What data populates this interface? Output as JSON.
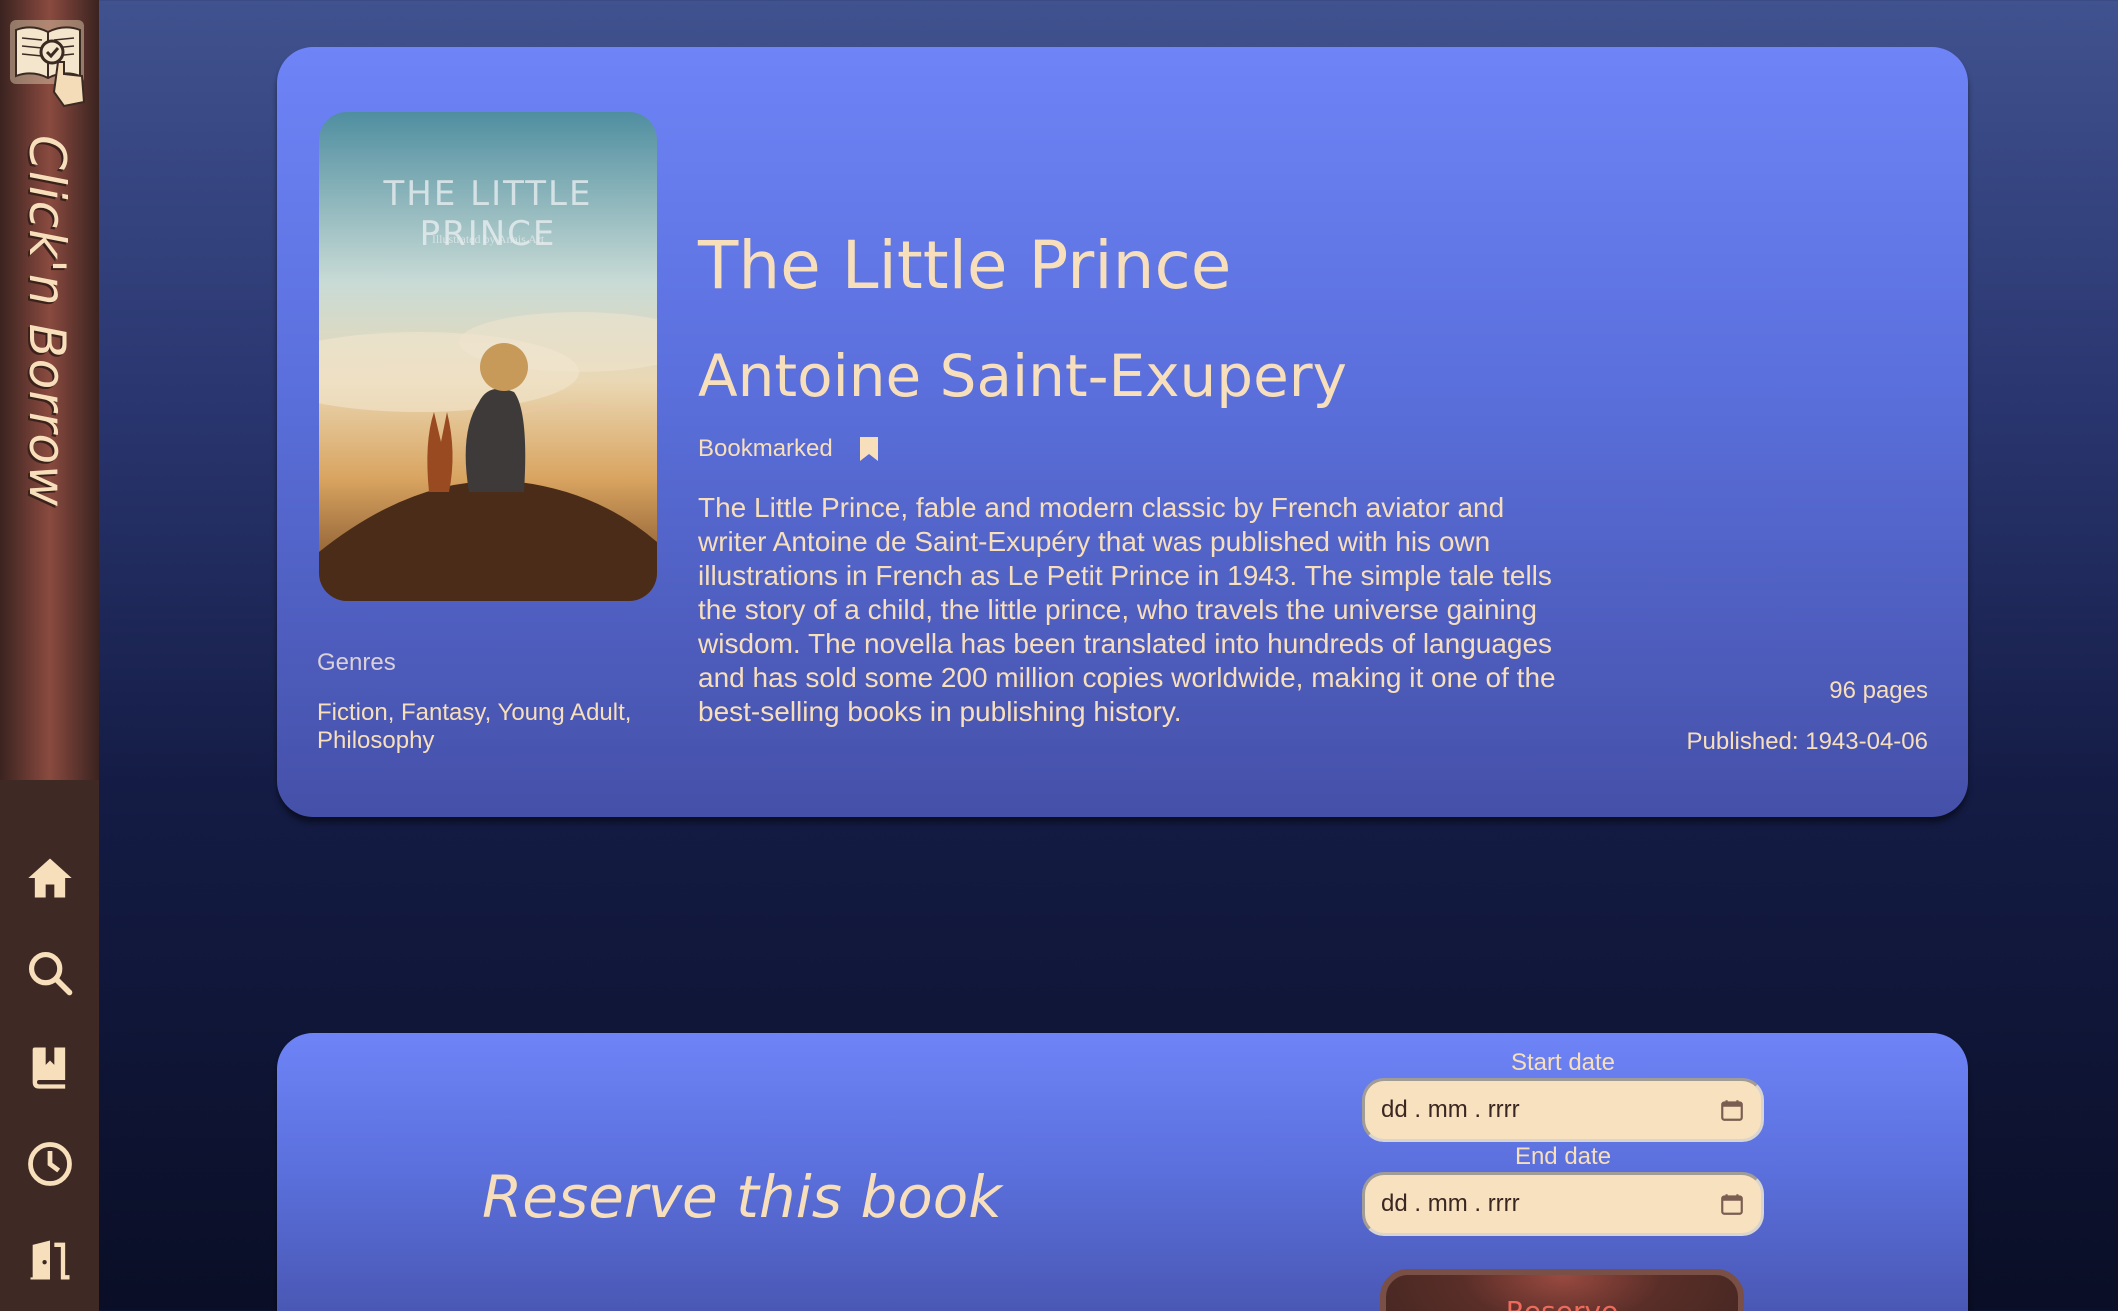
{
  "app": {
    "name": "Click'n Borrow"
  },
  "nav": [
    {
      "icon": "home-icon",
      "label": "Home"
    },
    {
      "icon": "search-icon",
      "label": "Search"
    },
    {
      "icon": "bookmark-book-icon",
      "label": "Bookmarks"
    },
    {
      "icon": "history-clock-icon",
      "label": "History"
    },
    {
      "icon": "logout-door-icon",
      "label": "Logout"
    }
  ],
  "book": {
    "cover_text": "THE LITTLE PRINCE",
    "cover_subtext": "Illustrated by Anais Art",
    "title": "The Little Prince",
    "author": "Antoine Saint-Exupery",
    "bookmark_status": "Bookmarked",
    "description": "The Little Prince, fable and modern classic by French aviator and writer Antoine de Saint-Exupéry that was published with his own illustrations in French as Le Petit Prince in 1943. The simple tale tells the story of a child, the little prince, who travels the universe gaining wisdom. The novella has been translated into hundreds of languages and has sold some 200 million copies worldwide, making it one of the best-selling books in publishing history.",
    "genres_label": "Genres",
    "genres": "Fiction, Fantasy, Young Adult, Philosophy",
    "pages": "96 pages",
    "published": "Published: 1943-04-06"
  },
  "reserve": {
    "title": "Reserve this book",
    "start_label": "Start date",
    "start_placeholder": "dd . mm . rrrr",
    "end_label": "End date",
    "end_placeholder": "dd . mm . rrrr",
    "button": "Reserve"
  },
  "colors": {
    "accent_text": "#f8dfbb",
    "sidebar": "#3e2924",
    "card": "#6e84f7",
    "button_text": "#ef6a5c"
  }
}
